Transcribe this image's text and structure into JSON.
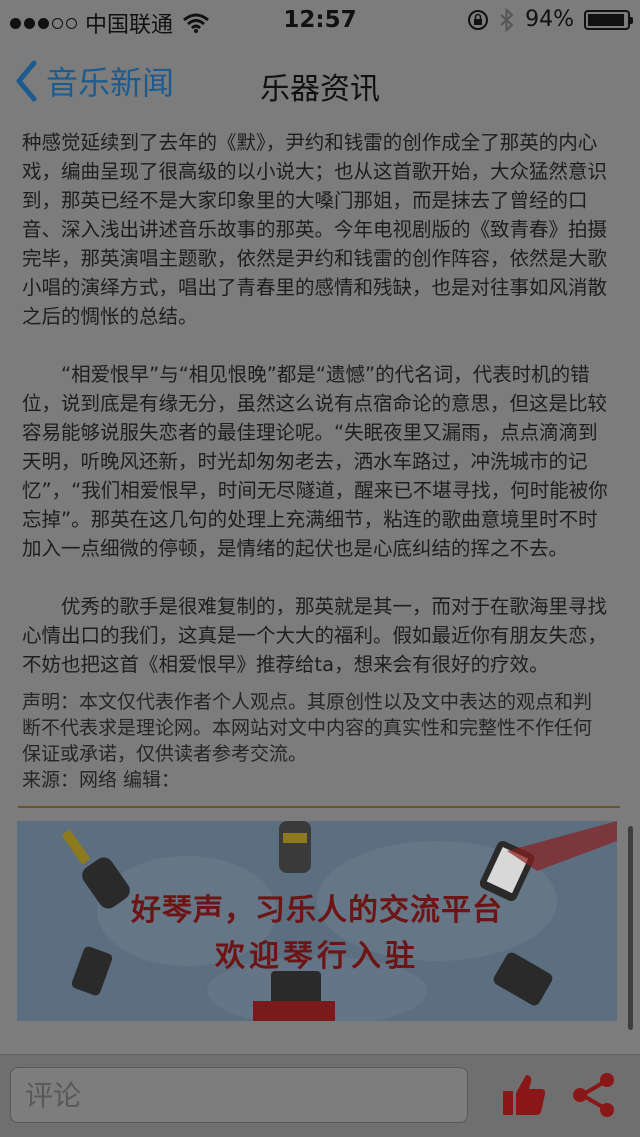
{
  "status": {
    "carrier": "中国联通",
    "time": "12:57",
    "battery": "94%",
    "battery_level": 0.94
  },
  "nav": {
    "back_label": "音乐新闻",
    "title": "乐器资讯"
  },
  "article": {
    "p1": "种感觉延续到了去年的《默》，尹约和钱雷的创作成全了那英的内心戏，编曲呈现了很高级的以小说大；也从这首歌开始，大众猛然意识到，那英已经不是大家印象里的大嗓门那姐，而是抹去了曾经的口音、深入浅出讲述音乐故事的那英。今年电视剧版的《致青春》拍摄完毕，那英演唱主题歌，依然是尹约和钱雷的创作阵容，依然是大歌小唱的演绎方式，唱出了青春里的感情和残缺，也是对往事如风消散之后的惆怅的总结。",
    "p2": "“相爱恨早”与“相见恨晚”都是“遗憾”的代名词，代表时机的错位，说到底是有缘无分，虽然这么说有点宿命论的意思，但这是比较容易能够说服失恋者的最佳理论呢。“失眠夜里又漏雨，点点滴滴到天明，听晚风还新，时光却匆匆老去，洒水车路过，冲洗城市的记忆”，“我们相爱恨早，时间无尽隧道，醒来已不堪寻找，何时能被你忘掉”。那英在这几句的处理上充满细节，粘连的歌曲意境里时不时加入一点细微的停顿，是情绪的起伏也是心底纠结的挥之不去。",
    "p3": "优秀的歌手是很难复制的，那英就是其一，而对于在歌海里寻找心情出口的我们，这真是一个大大的福利。假如最近你有朋友失恋，不妨也把这首《相爱恨早》推荐给ta，想来会有很好的疗效。",
    "notice": "声明：本文仅代表作者个人观点。其原创性以及文中表达的观点和判断不代表求是理论网。本网站对文中内容的真实性和完整性不作任何保证或承诺，仅供读者参考交流。",
    "source": "来源：网络 编辑："
  },
  "banner": {
    "title_line1": "好琴声，习乐人的交流平台",
    "title_line2": "欢迎琴行入驻"
  },
  "bottom": {
    "comment_placeholder": "评论"
  },
  "colors": {
    "nav_accent": "#1d5b8f",
    "action_red": "#8a1717",
    "banner_text": "#6d1414",
    "divider": "#6a5132"
  },
  "icons": [
    "wifi-icon",
    "orientation-lock-icon",
    "bluetooth-icon",
    "back-chevron-icon",
    "thumbs-up-icon",
    "share-icon",
    "microphone-icon",
    "phone-icon"
  ]
}
